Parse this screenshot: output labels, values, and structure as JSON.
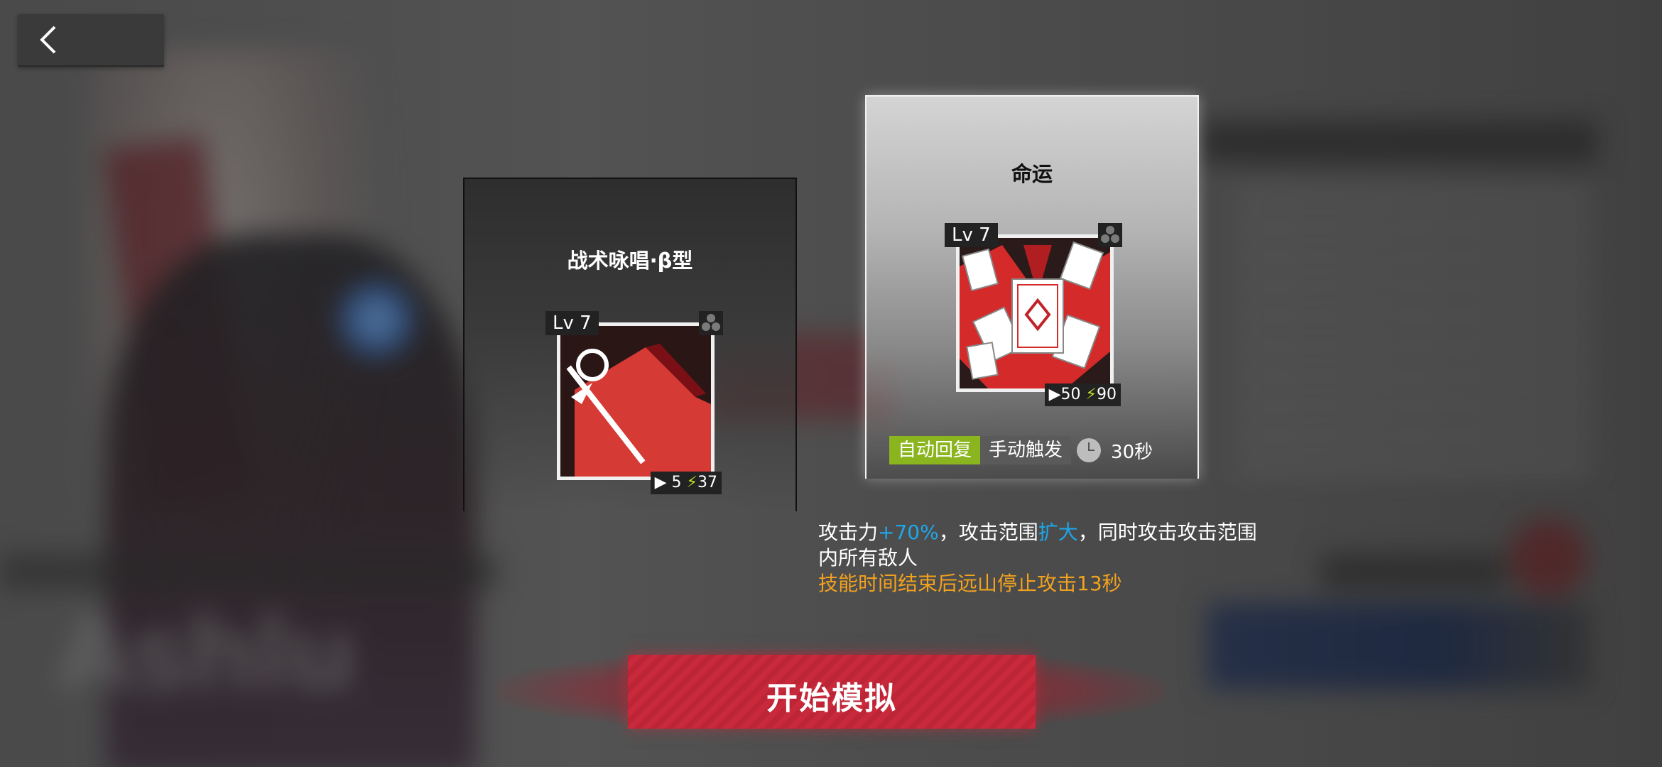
{
  "colors": {
    "accent_red": "#c82a3c",
    "highlight_blue": "#1fa6e8",
    "warning_orange": "#f2a21e",
    "recovery_green": "#8ab51e",
    "sp_bolt": "#c8e02a"
  },
  "skills": [
    {
      "name": "战术咏唱·β型",
      "level": "Lv 7",
      "initial_sp": "5",
      "sp_cost": "37",
      "icon": "staff-icon",
      "selected": false
    },
    {
      "name": "命运",
      "level": "Lv 7",
      "initial_sp": "50",
      "sp_cost": "90",
      "icon": "cards-icon",
      "selected": true
    }
  ],
  "selected_skill": {
    "recovery_type": "自动回复",
    "trigger_type": "手动触发",
    "duration": "30秒",
    "description": {
      "part1": "攻击力",
      "atk_bonus": "+70%",
      "part2": "，攻击范围",
      "range_change": "扩大",
      "part3": "，同时攻击攻击范围内所有敌人",
      "warning": "技能时间结束后远山停止攻击13秒"
    }
  },
  "start_button_label": "开始模拟",
  "background_name": "Ashlu"
}
